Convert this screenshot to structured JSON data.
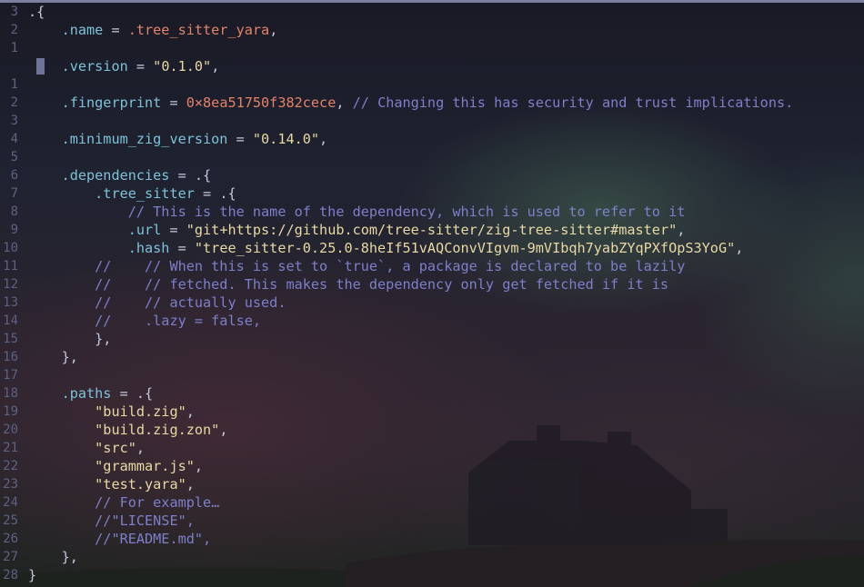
{
  "editor": {
    "lines": [
      {
        "num": "3",
        "tokens": [
          {
            "t": ".{",
            "c": "p"
          }
        ]
      },
      {
        "num": "2",
        "tokens": [
          {
            "t": "    ",
            "c": "p"
          },
          {
            "t": ".name",
            "c": "f"
          },
          {
            "t": " = ",
            "c": "p"
          },
          {
            "t": ".tree_sitter_yara",
            "c": "nm"
          },
          {
            "t": ",",
            "c": "p"
          }
        ]
      },
      {
        "num": "1",
        "tokens": []
      },
      {
        "num": "",
        "tokens": [
          {
            "t": "    ",
            "c": "p"
          },
          {
            "t": ".version",
            "c": "f"
          },
          {
            "t": " = ",
            "c": "p"
          },
          {
            "t": "\"0.1.0\"",
            "c": "s"
          },
          {
            "t": ",",
            "c": "p"
          }
        ]
      },
      {
        "num": "1",
        "tokens": []
      },
      {
        "num": "2",
        "tokens": [
          {
            "t": "    ",
            "c": "p"
          },
          {
            "t": ".fingerprint",
            "c": "f"
          },
          {
            "t": " = ",
            "c": "p"
          },
          {
            "t": "0×8ea51750f382cece",
            "c": "n"
          },
          {
            "t": ", ",
            "c": "p"
          },
          {
            "t": "// Changing this has security and trust implications.",
            "c": "c"
          }
        ]
      },
      {
        "num": "3",
        "tokens": []
      },
      {
        "num": "4",
        "tokens": [
          {
            "t": "    ",
            "c": "p"
          },
          {
            "t": ".minimum_zig_version",
            "c": "f"
          },
          {
            "t": " = ",
            "c": "p"
          },
          {
            "t": "\"0.14.0\"",
            "c": "s"
          },
          {
            "t": ",",
            "c": "p"
          }
        ]
      },
      {
        "num": "5",
        "tokens": []
      },
      {
        "num": "6",
        "tokens": [
          {
            "t": "    ",
            "c": "p"
          },
          {
            "t": ".dependencies",
            "c": "f"
          },
          {
            "t": " = .{",
            "c": "p"
          }
        ]
      },
      {
        "num": "7",
        "tokens": [
          {
            "t": "        ",
            "c": "p"
          },
          {
            "t": ".tree_sitter",
            "c": "f"
          },
          {
            "t": " = .{",
            "c": "p"
          }
        ]
      },
      {
        "num": "8",
        "tokens": [
          {
            "t": "            ",
            "c": "p"
          },
          {
            "t": "// This is the name of the dependency, which is used to refer to it",
            "c": "c"
          }
        ]
      },
      {
        "num": "9",
        "tokens": [
          {
            "t": "            ",
            "c": "p"
          },
          {
            "t": ".url",
            "c": "f"
          },
          {
            "t": " = ",
            "c": "p"
          },
          {
            "t": "\"git+https://github.com/tree-sitter/zig-tree-sitter#master\"",
            "c": "s"
          },
          {
            "t": ",",
            "c": "p"
          }
        ]
      },
      {
        "num": "10",
        "tokens": [
          {
            "t": "            ",
            "c": "p"
          },
          {
            "t": ".hash",
            "c": "f"
          },
          {
            "t": " = ",
            "c": "p"
          },
          {
            "t": "\"tree_sitter-0.25.0-8heIf51vAQConvVIgvm-9mVIbqh7yabZYqPXfOpS3YoG\"",
            "c": "s"
          },
          {
            "t": ",",
            "c": "p"
          }
        ]
      },
      {
        "num": "11",
        "tokens": [
          {
            "t": "        ",
            "c": "p"
          },
          {
            "t": "//    // When this is set to `true`, a package is declared to be lazily",
            "c": "c"
          }
        ]
      },
      {
        "num": "12",
        "tokens": [
          {
            "t": "        ",
            "c": "p"
          },
          {
            "t": "//    // fetched. This makes the dependency only get fetched if it is",
            "c": "c"
          }
        ]
      },
      {
        "num": "13",
        "tokens": [
          {
            "t": "        ",
            "c": "p"
          },
          {
            "t": "//    // actually used.",
            "c": "c"
          }
        ]
      },
      {
        "num": "14",
        "tokens": [
          {
            "t": "        ",
            "c": "p"
          },
          {
            "t": "//    .lazy = false,",
            "c": "c"
          }
        ]
      },
      {
        "num": "15",
        "tokens": [
          {
            "t": "        },",
            "c": "p"
          }
        ]
      },
      {
        "num": "16",
        "tokens": [
          {
            "t": "    },",
            "c": "p"
          }
        ]
      },
      {
        "num": "17",
        "tokens": []
      },
      {
        "num": "18",
        "tokens": [
          {
            "t": "    ",
            "c": "p"
          },
          {
            "t": ".paths",
            "c": "f"
          },
          {
            "t": " = .{",
            "c": "p"
          }
        ]
      },
      {
        "num": "19",
        "tokens": [
          {
            "t": "        ",
            "c": "p"
          },
          {
            "t": "\"build.zig\"",
            "c": "s"
          },
          {
            "t": ",",
            "c": "p"
          }
        ]
      },
      {
        "num": "20",
        "tokens": [
          {
            "t": "        ",
            "c": "p"
          },
          {
            "t": "\"build.zig.zon\"",
            "c": "s"
          },
          {
            "t": ",",
            "c": "p"
          }
        ]
      },
      {
        "num": "21",
        "tokens": [
          {
            "t": "        ",
            "c": "p"
          },
          {
            "t": "\"src\"",
            "c": "s"
          },
          {
            "t": ",",
            "c": "p"
          }
        ]
      },
      {
        "num": "22",
        "tokens": [
          {
            "t": "        ",
            "c": "p"
          },
          {
            "t": "\"grammar.js\"",
            "c": "s"
          },
          {
            "t": ",",
            "c": "p"
          }
        ]
      },
      {
        "num": "23",
        "tokens": [
          {
            "t": "        ",
            "c": "p"
          },
          {
            "t": "\"test.yara\"",
            "c": "s"
          },
          {
            "t": ",",
            "c": "p"
          }
        ]
      },
      {
        "num": "24",
        "tokens": [
          {
            "t": "        ",
            "c": "p"
          },
          {
            "t": "// For example…",
            "c": "c"
          }
        ]
      },
      {
        "num": "25",
        "tokens": [
          {
            "t": "        ",
            "c": "p"
          },
          {
            "t": "//\"LICENSE\",",
            "c": "c"
          }
        ]
      },
      {
        "num": "26",
        "tokens": [
          {
            "t": "        ",
            "c": "p"
          },
          {
            "t": "//\"README.md\",",
            "c": "c"
          }
        ]
      },
      {
        "num": "27",
        "tokens": [
          {
            "t": "    },",
            "c": "p"
          }
        ]
      },
      {
        "num": "28",
        "tokens": [
          {
            "t": "}",
            "c": "p"
          }
        ]
      }
    ]
  },
  "colors": {
    "punctuation": "#c5c8dc",
    "field": "#7dc2d8",
    "string": "#e7d8a4",
    "number": "#e3826a",
    "comment": "#7e7fc9",
    "line_number": "#5d6280"
  }
}
